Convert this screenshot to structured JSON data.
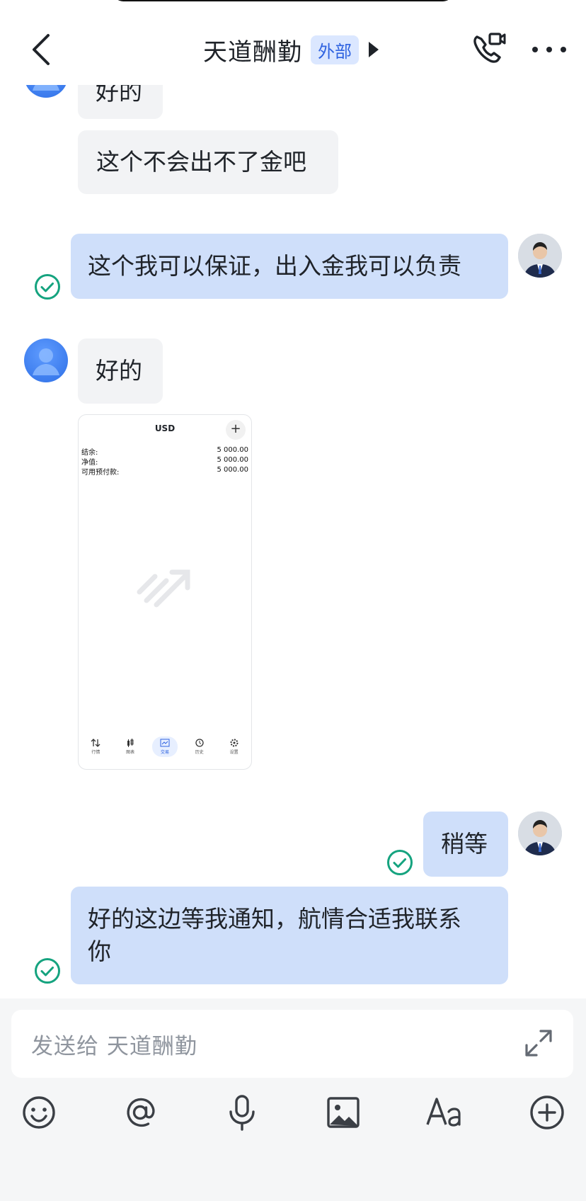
{
  "header": {
    "title": "天道酬勤",
    "badge": "外部"
  },
  "messages": [
    {
      "from": "peer",
      "text": "好的"
    },
    {
      "from": "peer",
      "text": "这个不会出不了金吧"
    },
    {
      "from": "me",
      "text": "这个我可以保证，出入金我可以负责",
      "read": true
    },
    {
      "from": "peer",
      "text": "好的"
    },
    {
      "from": "peer",
      "type": "image"
    },
    {
      "from": "me",
      "text": "稍等",
      "read": true
    },
    {
      "from": "me",
      "text_line1": "好的这边等我通知，航情合适我联系",
      "text_line2": "你",
      "read": true
    }
  ],
  "screenshot": {
    "title": "USD",
    "rows": [
      {
        "label": "结余:",
        "value": "5 000.00"
      },
      {
        "label": "净值:",
        "value": "5 000.00"
      },
      {
        "label": "可用预付款:",
        "value": "5 000.00"
      }
    ],
    "nav": [
      "行情",
      "图表",
      "交易",
      "历史",
      "设置"
    ],
    "active_nav": "交易"
  },
  "composer": {
    "placeholder": "发送给 天道酬勤"
  },
  "toolbar_icons": [
    "emoji-icon",
    "mention-icon",
    "microphone-icon",
    "image-icon",
    "text-format-icon",
    "add-icon"
  ],
  "colors": {
    "outgoing_bubble": "#cfdffa",
    "incoming_bubble": "#f2f3f5",
    "read_check": "#15a37f",
    "badge_text": "#2f63e0",
    "badge_bg": "#dbe7ff"
  }
}
